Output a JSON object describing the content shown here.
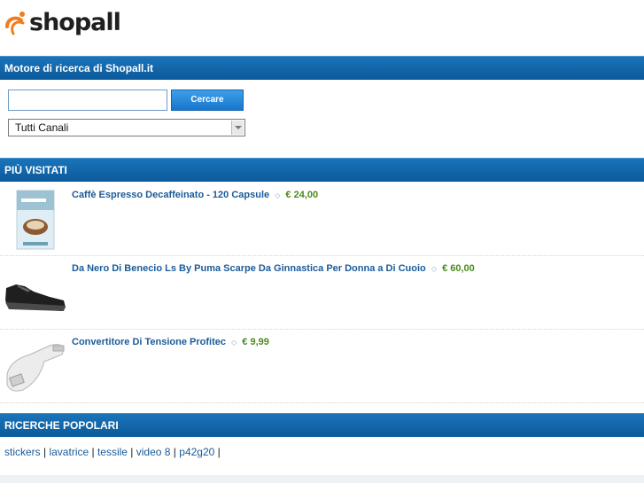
{
  "logo": {
    "text": "shopall"
  },
  "search": {
    "header": "Motore di ricerca di Shopall.it",
    "input_value": "",
    "button_label": "Cercare",
    "channel_selected": "Tutti Canali"
  },
  "most_visited": {
    "header": "PIÙ VISITATI",
    "products": [
      {
        "title": "Caffè Espresso Decaffeinato - 120 Capsule",
        "price": "€ 24,00",
        "thumbnail_icon": "coffee-box-icon"
      },
      {
        "title": "Da Nero Di Benecio Ls By Puma Scarpe Da Ginnastica Per Donna a Di Cuoio",
        "price": "€ 60,00",
        "thumbnail_icon": "shoe-icon"
      },
      {
        "title": "Convertitore Di Tensione Profitec",
        "price": "€ 9,99",
        "thumbnail_icon": "car-charger-icon"
      }
    ]
  },
  "popular": {
    "header": "RICERCHE POPOLARI",
    "links": [
      "stickers",
      "lavatrice",
      "tessile",
      "video 8",
      "p42g20"
    ]
  },
  "colors": {
    "bar": "#0b5a9c",
    "link": "#1a5b99",
    "price": "#4a8a1a",
    "logo_accent": "#f07c1a"
  }
}
